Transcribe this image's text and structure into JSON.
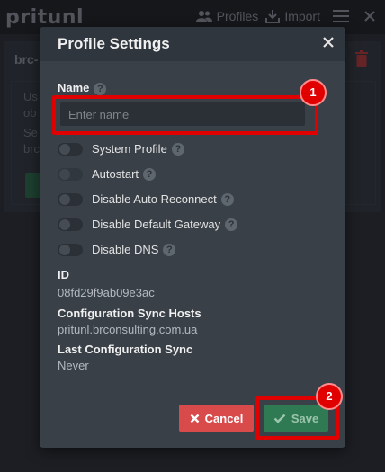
{
  "app": {
    "logo": "pritunl",
    "nav": {
      "profiles_label": "Profiles",
      "import_label": "Import"
    }
  },
  "background": {
    "profile_title": "brc-",
    "lines": [
      "Us",
      "ob",
      "Se",
      "brc"
    ]
  },
  "modal": {
    "title": "Profile Settings",
    "name_label": "Name",
    "name_value": "",
    "name_placeholder": "Enter name",
    "toggles": [
      {
        "label": "System Profile",
        "enabled": false,
        "help": true
      },
      {
        "label": "Autostart",
        "enabled": false,
        "help": true
      },
      {
        "label": "Disable Auto Reconnect",
        "enabled": false,
        "help": true
      },
      {
        "label": "Disable Default Gateway",
        "enabled": false,
        "help": true
      },
      {
        "label": "Disable DNS",
        "enabled": false,
        "help": true
      }
    ],
    "info": {
      "id_label": "ID",
      "id_value": "08fd29f9ab09e3ac",
      "sync_hosts_label": "Configuration Sync Hosts",
      "sync_hosts_value": "pritunl.brconsulting.com.ua",
      "last_sync_label": "Last Configuration Sync",
      "last_sync_value": "Never"
    },
    "buttons": {
      "cancel_label": "Cancel",
      "save_label": "Save"
    }
  },
  "annotations": [
    {
      "number": "1"
    },
    {
      "number": "2"
    }
  ],
  "colors": {
    "accent_red": "#d94b4b",
    "save_green": "#2f7a52",
    "annotation_red": "#e00000"
  }
}
